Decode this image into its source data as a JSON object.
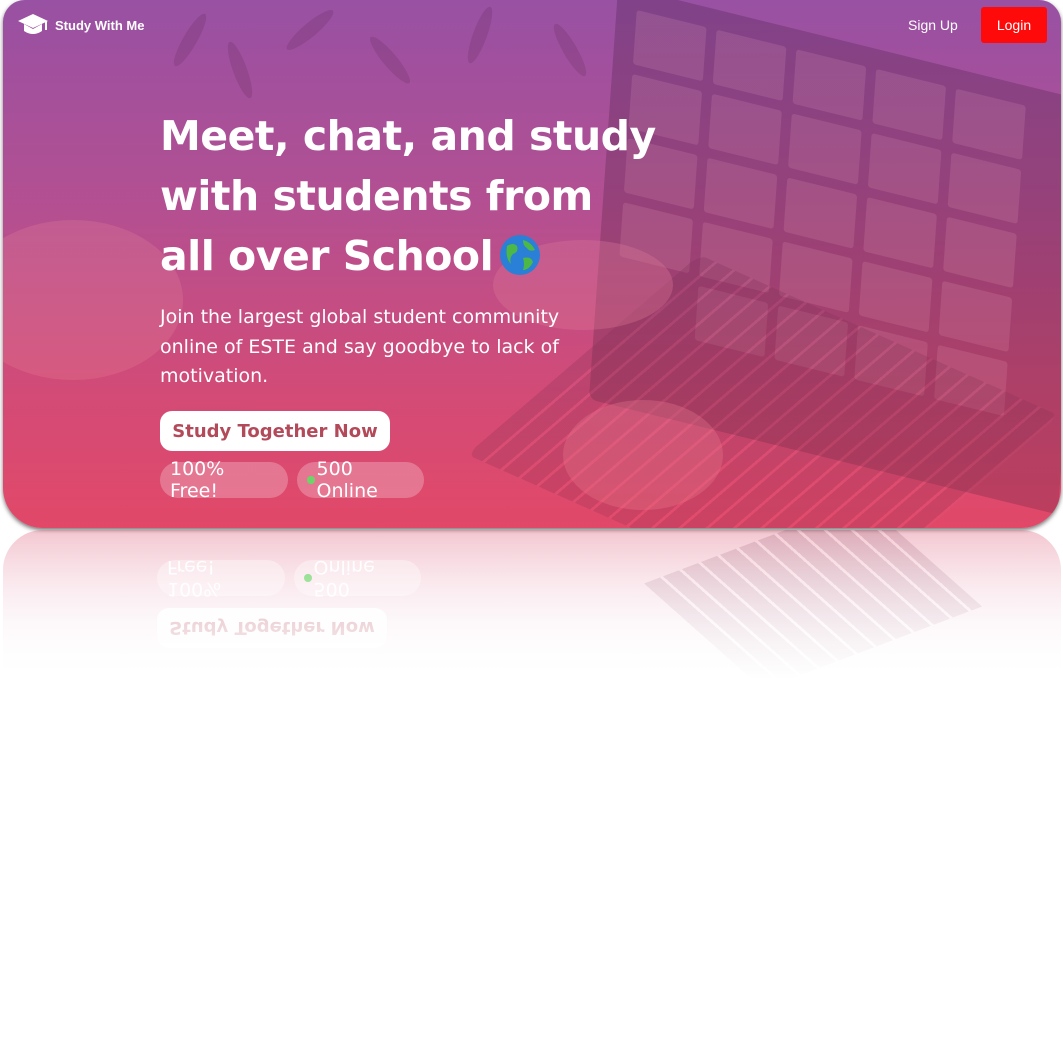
{
  "nav": {
    "brand": "Study With Me",
    "signup_label": "Sign Up",
    "login_label": "Login"
  },
  "hero": {
    "headline_line1": "Meet, chat, and study",
    "headline_line2": "with students from",
    "headline_line3": "all over School",
    "subtext": "Join the largest global student community online of ESTE and say goodbye to lack of motivation.",
    "cta_label": "Study Together Now",
    "badge_free": "100% Free!",
    "badge_online": "500 Online"
  },
  "colors": {
    "login_bg": "#ff0a0a",
    "cta_text": "#b24a5a",
    "online_dot": "#6fd36a",
    "hero_top": "#9a5aa6",
    "hero_bottom": "#dd4b6d"
  },
  "icons": {
    "logo": "graduation-cap-icon",
    "globe": "globe-icon"
  }
}
